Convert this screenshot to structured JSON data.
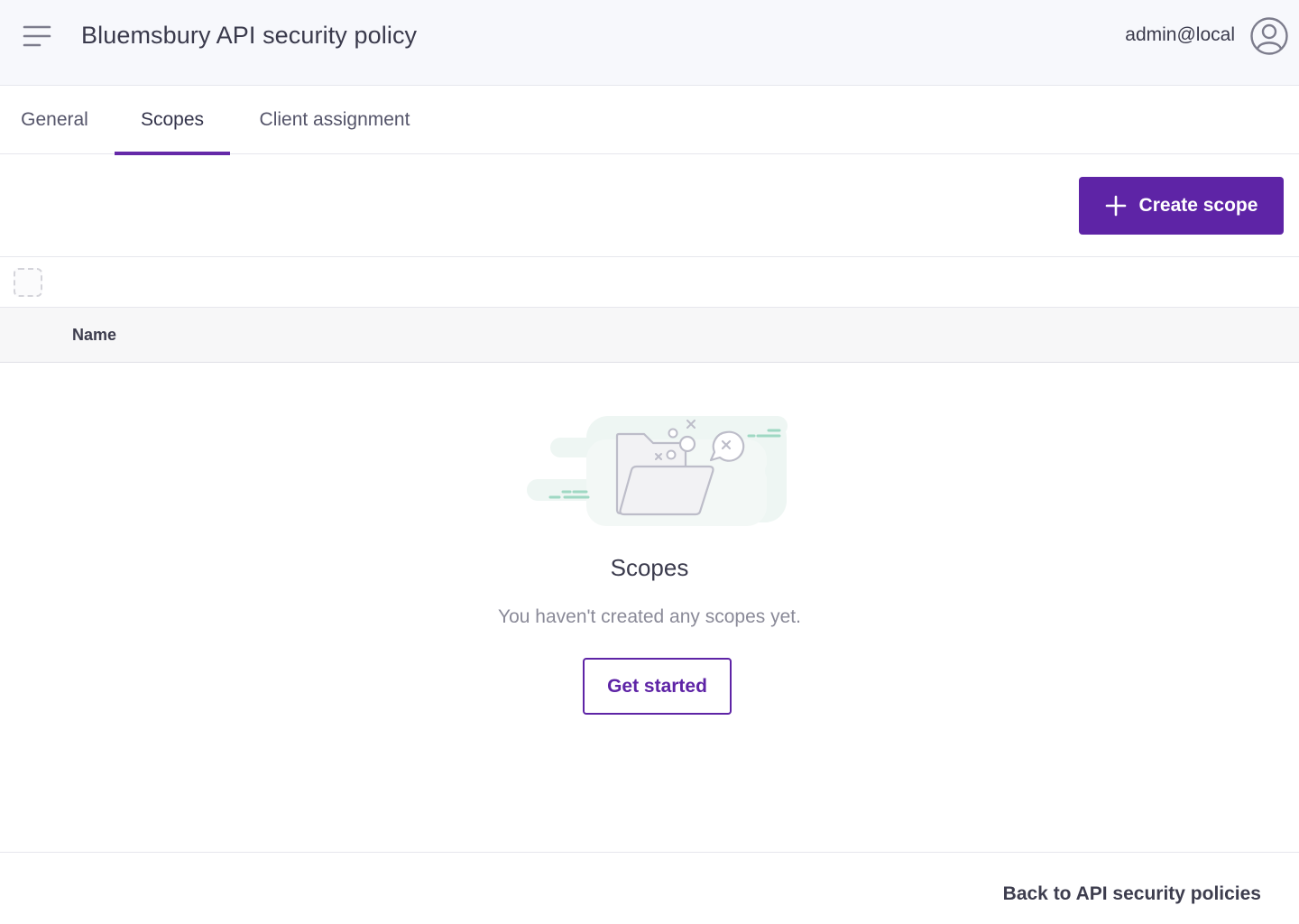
{
  "header": {
    "title": "Bluemsbury API security policy",
    "user": "admin@local",
    "icons": {
      "menu": "menu-icon",
      "avatar": "user-circle-icon"
    }
  },
  "tabs": [
    {
      "label": "General",
      "active": false
    },
    {
      "label": "Scopes",
      "active": true
    },
    {
      "label": "Client assignment",
      "active": false
    }
  ],
  "toolbar": {
    "create_label": "Create scope",
    "icon": "plus-icon"
  },
  "table": {
    "columns": [
      "Name"
    ]
  },
  "empty_state": {
    "title": "Scopes",
    "message": "You haven't created any scopes yet.",
    "action_label": "Get started",
    "illustration": "empty-folder-illustration"
  },
  "footer": {
    "back_label": "Back to API security policies"
  },
  "colors": {
    "accent": "#5e24a6",
    "header_bg": "#f7f8fc",
    "table_head_bg": "#f7f7f8",
    "text": "#3d3d4e",
    "muted_text": "#8a8a98"
  }
}
